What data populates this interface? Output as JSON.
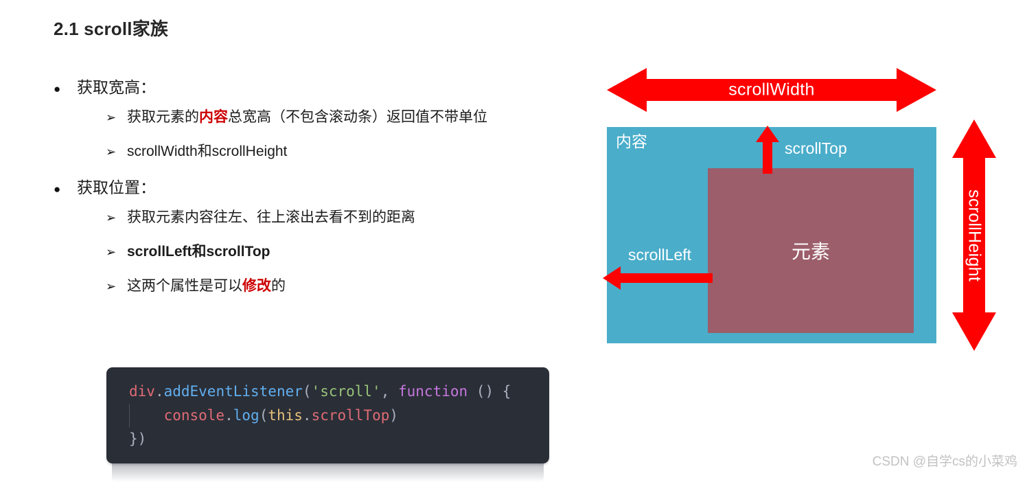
{
  "page": {
    "title": "2.1 scroll家族",
    "watermark": "CSDN @自学cs的小菜鸡"
  },
  "outline": [
    {
      "marker": "●",
      "text": "获取宽高：",
      "children": [
        {
          "marker": "➢",
          "parts": [
            {
              "t": "获取元素的",
              "style": "normal"
            },
            {
              "t": "内容",
              "style": "red-bold"
            },
            {
              "t": "总宽高（不包含滚动条）返回值不带单位",
              "style": "normal"
            }
          ]
        },
        {
          "marker": "➢",
          "parts": [
            {
              "t": "scrollWidth和scrollHeight",
              "style": "normal"
            }
          ]
        }
      ]
    },
    {
      "marker": "●",
      "text": "获取位置：",
      "children": [
        {
          "marker": "➢",
          "parts": [
            {
              "t": "获取元素内容往左、往上滚出去看不到的距离",
              "style": "normal"
            }
          ]
        },
        {
          "marker": "➢",
          "parts": [
            {
              "t": "scrollLeft和scrollTop",
              "style": "bold"
            }
          ]
        },
        {
          "marker": "➢",
          "parts": [
            {
              "t": "这两个属性是可以",
              "style": "normal"
            },
            {
              "t": "修改",
              "style": "red-bold"
            },
            {
              "t": "的",
              "style": "normal"
            }
          ]
        }
      ]
    }
  ],
  "code": {
    "language": "javascript",
    "background": "#2a2e37",
    "lines": [
      [
        {
          "t": "div",
          "c": "c-var"
        },
        {
          "t": ".",
          "c": "c-punc"
        },
        {
          "t": "addEventListener",
          "c": "c-fn"
        },
        {
          "t": "(",
          "c": "c-punc"
        },
        {
          "t": "'scroll'",
          "c": "c-str"
        },
        {
          "t": ", ",
          "c": "c-punc"
        },
        {
          "t": "function",
          "c": "c-kw"
        },
        {
          "t": " () {",
          "c": "c-punc"
        }
      ],
      [
        {
          "t": "    ",
          "c": "c-punc"
        },
        {
          "t": "console",
          "c": "c-var"
        },
        {
          "t": ".",
          "c": "c-punc"
        },
        {
          "t": "log",
          "c": "c-fn"
        },
        {
          "t": "(",
          "c": "c-punc"
        },
        {
          "t": "this",
          "c": "c-this"
        },
        {
          "t": ".",
          "c": "c-punc"
        },
        {
          "t": "scrollTop",
          "c": "c-var"
        },
        {
          "t": ")",
          "c": "c-punc"
        }
      ],
      [
        {
          "t": "})",
          "c": "c-punc"
        }
      ]
    ]
  },
  "diagram": {
    "content_box_label": "内容",
    "element_box_label": "元素",
    "scroll_width_label": "scrollWidth",
    "scroll_height_label": "scrollHeight",
    "scroll_top_label": "scrollTop",
    "scroll_left_label": "scrollLeft",
    "colors": {
      "content_box": "#4aadca",
      "element_box": "#9b5e6a",
      "arrow": "#ff0000",
      "label_text": "#ffffff"
    }
  }
}
